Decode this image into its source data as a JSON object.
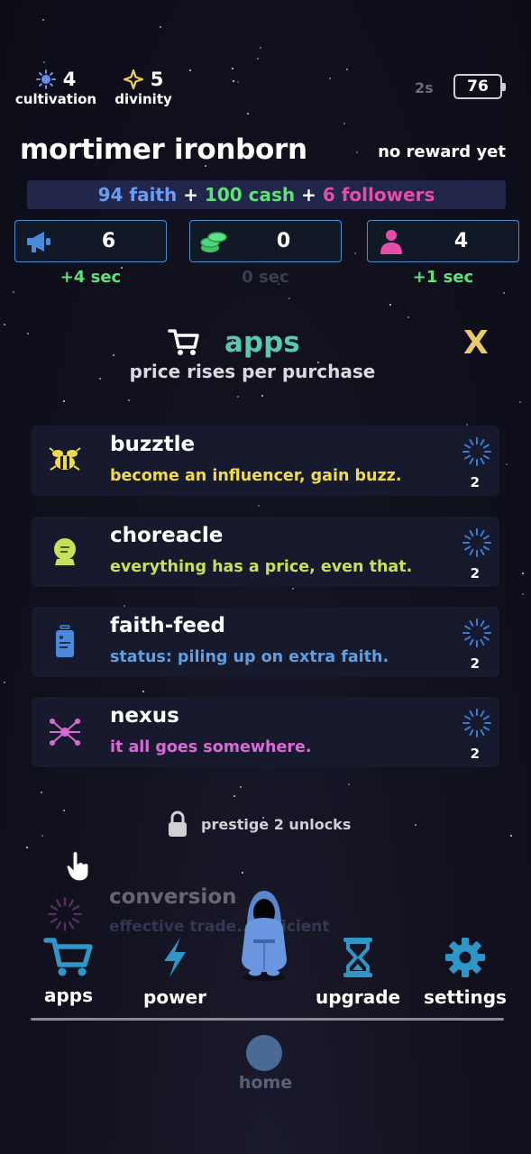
{
  "stats": {
    "cultivation": {
      "value": "4",
      "label": "cultivation",
      "icon": "sun-icon",
      "color": "#6a8cf0"
    },
    "divinity": {
      "value": "5",
      "label": "divinity",
      "icon": "sparkle-icon",
      "color": "#f0d24a"
    }
  },
  "status": {
    "timer": "2s",
    "battery": "76"
  },
  "player": {
    "name": "mortimer ironborn",
    "reward": "no reward yet"
  },
  "reward_bar": {
    "faith": "94 faith",
    "plus1": " + ",
    "cash": "100 cash",
    "plus2": " + ",
    "followers": "6 followers"
  },
  "resources": [
    {
      "icon": "megaphone-icon",
      "value": "6",
      "rate": "+4 sec",
      "rate_color": "#5fe07b"
    },
    {
      "icon": "coins-icon",
      "value": "0",
      "rate": "0 sec",
      "rate_color": "#3a3f4e"
    },
    {
      "icon": "person-icon",
      "value": "4",
      "rate": "+1 sec",
      "rate_color": "#5fe07b"
    }
  ],
  "apps_panel": {
    "title": "apps",
    "subtitle": "price rises per purchase",
    "close": "X"
  },
  "apps": [
    {
      "name": "buzztle",
      "desc": "become an influencer, gain buzz.",
      "desc_color": "#f0dc4a",
      "count": "2",
      "icon": "bee-icon"
    },
    {
      "name": "choreacle",
      "desc": "everything has a price, even that.",
      "desc_color": "#c6e05a",
      "count": "2",
      "icon": "crystal-ball-icon"
    },
    {
      "name": "faith-feed",
      "desc": "status: piling up on extra faith.",
      "desc_color": "#5f9ee0",
      "count": "2",
      "icon": "phone-icon"
    },
    {
      "name": "nexus",
      "desc": "it all goes somewhere.",
      "desc_color": "#d86ad8",
      "count": "2",
      "icon": "network-icon"
    }
  ],
  "locked": {
    "text": "prestige 2 unlocks"
  },
  "faded_app": {
    "name": "conversion",
    "desc": "effective trade... efficient"
  },
  "nav": {
    "apps": "apps",
    "power": "power",
    "upgrade": "upgrade",
    "settings": "settings",
    "home": "home"
  }
}
